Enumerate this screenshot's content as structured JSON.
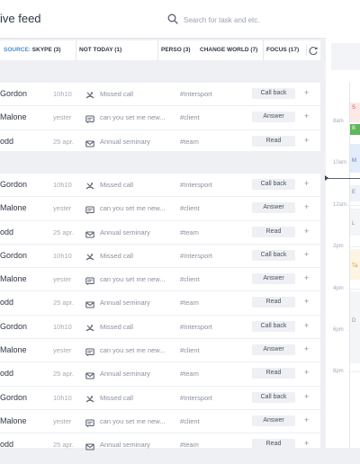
{
  "header": {
    "title": "ive feed"
  },
  "search": {
    "placeholder": "Search for task and etc."
  },
  "filters": {
    "source_label": "SOURCE:",
    "source_value": "SKYPE (3)",
    "not_today": "NOT TODAY (1)",
    "perso": "PERSO (3)",
    "change_world": "CHANGE WORLD (7)",
    "focus": "FOCUS (17)"
  },
  "feed_groups": [
    {
      "rows": [
        {
          "name": "Gordon",
          "time": "10h10",
          "icon": "missed-call-icon",
          "text": "Missed call",
          "tag": "#Intersport",
          "action": "Call back"
        },
        {
          "name": "Malone",
          "time": "yester",
          "icon": "message-icon",
          "text": "can you set me new...",
          "tag": "#client",
          "action": "Answer"
        },
        {
          "name": "odd",
          "time": "25 apr.",
          "icon": "mail-icon",
          "text": "Annual seminary",
          "tag": "#team",
          "action": "Read"
        }
      ]
    },
    {
      "rows": [
        {
          "name": "Gordon",
          "time": "10h10",
          "icon": "missed-call-icon",
          "text": "Missed call",
          "tag": "#Intersport",
          "action": "Call back"
        },
        {
          "name": "Malone",
          "time": "yester",
          "icon": "message-icon",
          "text": "can you set me new...",
          "tag": "#client",
          "action": "Answer"
        },
        {
          "name": "odd",
          "time": "25 apr.",
          "icon": "mail-icon",
          "text": "Annual seminary",
          "tag": "#team",
          "action": "Read"
        },
        {
          "name": "Gordon",
          "time": "10h10",
          "icon": "missed-call-icon",
          "text": "Missed call",
          "tag": "#Intersport",
          "action": "Call back"
        },
        {
          "name": "Malone",
          "time": "yester",
          "icon": "message-icon",
          "text": "can you set me new...",
          "tag": "#client",
          "action": "Answer"
        },
        {
          "name": "odd",
          "time": "25 apr.",
          "icon": "mail-icon",
          "text": "Annual seminary",
          "tag": "#team",
          "action": "Read"
        },
        {
          "name": "Gordon",
          "time": "10h10",
          "icon": "missed-call-icon",
          "text": "Missed call",
          "tag": "#Intersport",
          "action": "Call back"
        },
        {
          "name": "Malone",
          "time": "yester",
          "icon": "message-icon",
          "text": "can you set me new...",
          "tag": "#client",
          "action": "Answer"
        },
        {
          "name": "odd",
          "time": "25 apr.",
          "icon": "mail-icon",
          "text": "Annual seminary",
          "tag": "#team",
          "action": "Read"
        },
        {
          "name": "Gordon",
          "time": "10h10",
          "icon": "missed-call-icon",
          "text": "Missed call",
          "tag": "#Intersport",
          "action": "Call back"
        },
        {
          "name": "Malone",
          "time": "yester",
          "icon": "message-icon",
          "text": "can you set me new...",
          "tag": "#client",
          "action": "Answer"
        },
        {
          "name": "odd",
          "time": "25 apr.",
          "icon": "mail-icon",
          "text": "Annual seminary",
          "tag": "#team",
          "action": "Read"
        }
      ]
    }
  ],
  "calendar": {
    "hours": [
      "8am",
      "10am",
      "12am",
      "2pm",
      "4pm",
      "6pm",
      "8pm"
    ],
    "events": [
      {
        "label": "S",
        "bg": "#fde8e8",
        "fg": "#d9534f"
      },
      {
        "label": "B",
        "bg": "#5cb85c",
        "fg": "#ffffff"
      },
      {
        "label": "M",
        "bg": "#e3ecf9",
        "fg": "#4a7fc1"
      },
      {
        "label": "E",
        "bg": "#eef3fa",
        "fg": "#7a8aa8"
      },
      {
        "label": "L",
        "bg": "#f4f5f7",
        "fg": "#8a91a0"
      },
      {
        "label": "Ta",
        "bg": "#fdf4e3",
        "fg": "#e09a2b"
      },
      {
        "label": "D",
        "bg": "#f4f5f7",
        "fg": "#8a91a0"
      }
    ]
  },
  "colors": {
    "accent": "#4a8fd8",
    "divider": "#eceef2",
    "button_bg": "#eef0f3"
  }
}
